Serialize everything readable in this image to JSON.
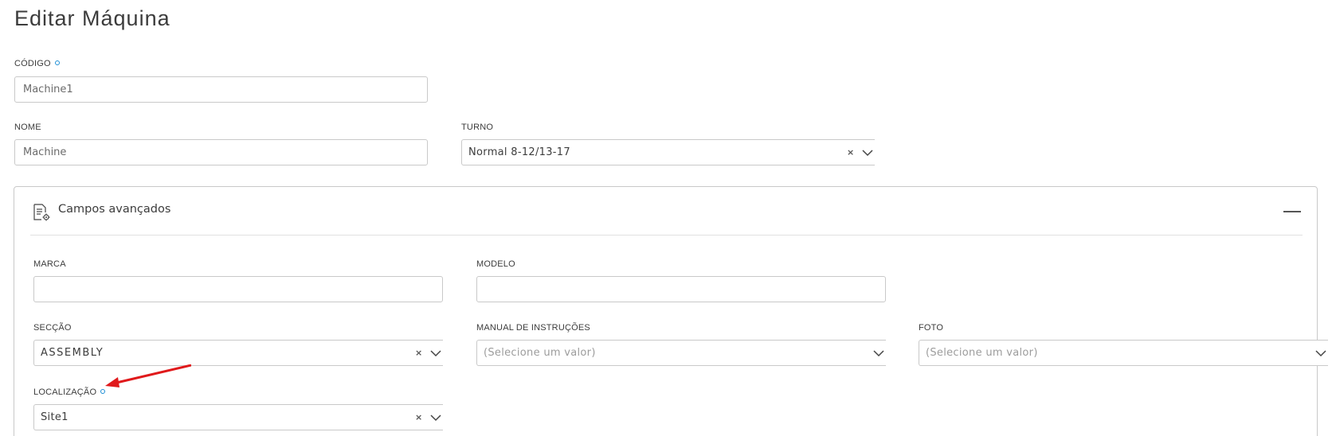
{
  "page": {
    "title": "Editar Máquina"
  },
  "fields": {
    "codigo": {
      "label": "CÓDIGO",
      "value": "Machine1"
    },
    "nome": {
      "label": "NOME",
      "value": "Machine"
    },
    "turno": {
      "label": "TURNO",
      "value": "Normal 8-12/13-17"
    }
  },
  "advanced": {
    "title": "Campos avançados",
    "marca": {
      "label": "MARCA",
      "value": ""
    },
    "modelo": {
      "label": "MODELO",
      "value": ""
    },
    "seccao": {
      "label": "SECÇÃO",
      "value": "ASSEMBLY"
    },
    "manual": {
      "label": "MANUAL DE INSTRUÇÕES",
      "placeholder": "(Selecione um valor)"
    },
    "foto": {
      "label": "FOTO",
      "placeholder": "(Selecione um valor)"
    },
    "localizacao": {
      "label": "LOCALIZAÇÃO",
      "value": "Site1"
    }
  },
  "glyphs": {
    "clear": "×"
  },
  "colors": {
    "required_dot": "#1f8fd6",
    "annotation_arrow": "#e0191b"
  }
}
